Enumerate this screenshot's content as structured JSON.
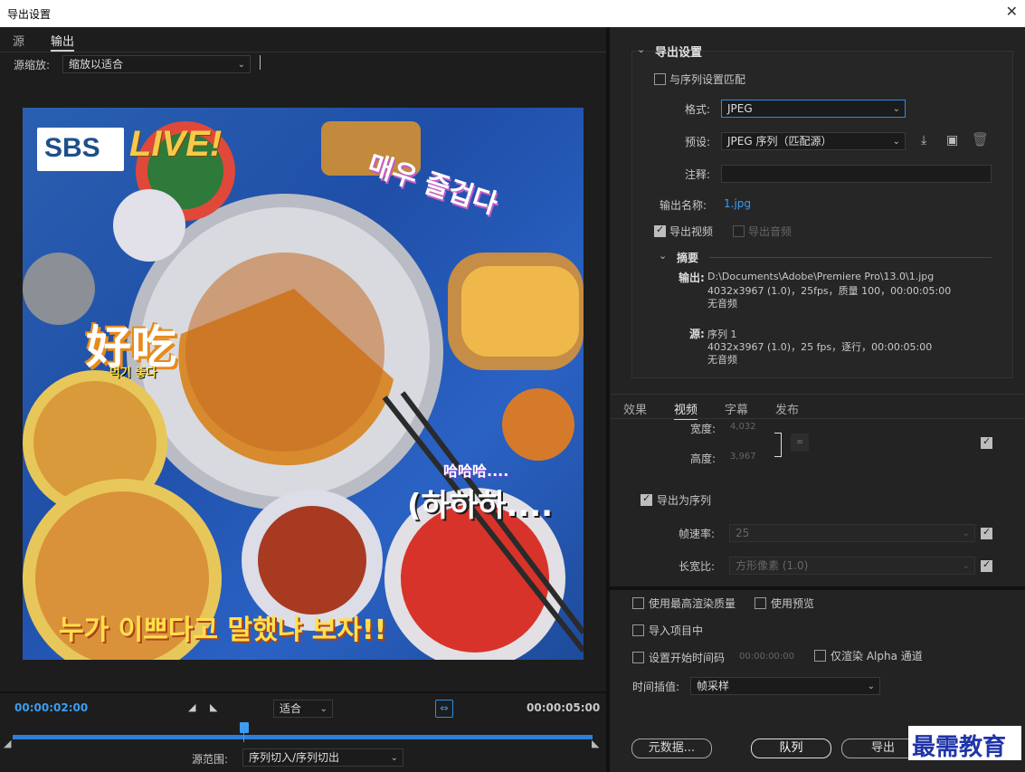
{
  "window": {
    "title": "导出设置",
    "close_glyph": "✕"
  },
  "left": {
    "tabs": [
      "源",
      "输出"
    ],
    "source_scale_label": "源缩放:",
    "source_scale_value": "缩放以适合",
    "preview": {
      "logo_sbs": "SBS",
      "logo_live": "LIVE!",
      "caption_top": "매우 즐겁다",
      "caption_mid": "好吃",
      "caption_mid_sub": "먹기 좋다",
      "caption_laugh_small": "哈哈哈....",
      "caption_laugh": "(하하하....",
      "caption_bottom": "누가 이쁘다고 말했냐 보자!!"
    },
    "timecode_current": "00:00:02:00",
    "timecode_end": "00:00:05:00",
    "fit_value": "适合",
    "source_range_label": "源范围:",
    "source_range_value": "序列切入/序列切出"
  },
  "export": {
    "section_title": "导出设置",
    "match_sequence_label": "与序列设置匹配",
    "format_label": "格式:",
    "format_value": "JPEG",
    "preset_label": "预设:",
    "preset_value": "JPEG 序列（匹配源）",
    "comment_label": "注释:",
    "output_name_label": "输出名称:",
    "output_name_value": "1.jpg",
    "export_video_label": "导出视频",
    "export_audio_label": "导出音频",
    "summary_title": "摘要",
    "summary_output_label": "输出:",
    "summary_output_path": "D:\\Documents\\Adobe\\Premiere Pro\\13.0\\1.jpg",
    "summary_output_detail": "4032x3967 (1.0)，25fps，质量 100，00:00:05:00",
    "summary_output_audio": "无音频",
    "summary_source_label": "源:",
    "summary_source_name": "序列 1",
    "summary_source_detail": "4032x3967 (1.0)，25 fps，逐行，00:00:05:00",
    "summary_source_audio": "无音频"
  },
  "video_tabs": [
    "效果",
    "视频",
    "字幕",
    "发布"
  ],
  "video": {
    "width_label": "宽度:",
    "width_value": "4,032",
    "height_label": "高度:",
    "height_value": "3,967",
    "export_as_sequence_label": "导出为序列",
    "frame_rate_label": "帧速率:",
    "frame_rate_value": "25",
    "aspect_label": "长宽比:",
    "aspect_value": "方形像素 (1.0)"
  },
  "bottom": {
    "max_quality_label": "使用最高渲染质量",
    "use_preview_label": "使用预览",
    "import_project_label": "导入项目中",
    "set_start_tc_label": "设置开始时间码",
    "start_tc_value": "00:00:00:00",
    "alpha_only_label": "仅渲染 Alpha 通道",
    "time_interp_label": "时间插值:",
    "time_interp_value": "帧采样",
    "metadata_button": "元数据...",
    "queue_button": "队列",
    "export_button": "导出",
    "watermark": "最需教育"
  },
  "colors": {
    "accent": "#2d8ceb",
    "timecode": "#3d9cf0",
    "panel": "#232323"
  }
}
